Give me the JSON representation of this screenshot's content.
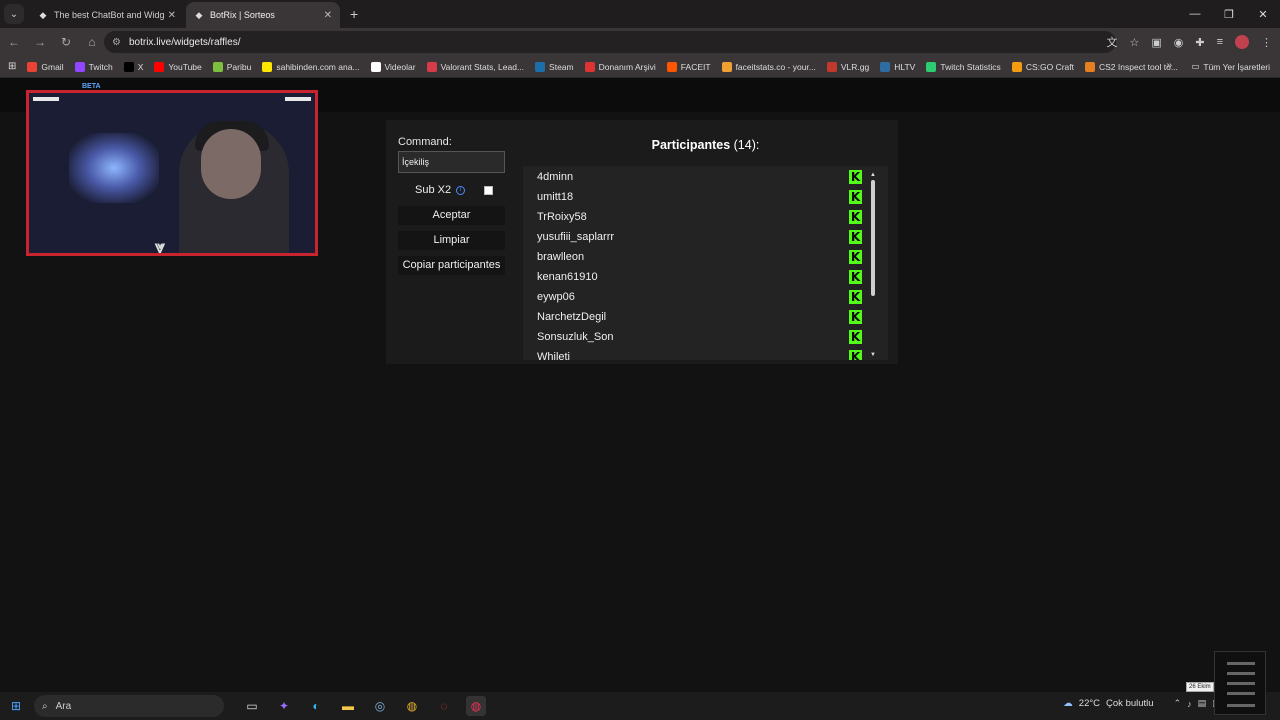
{
  "browser": {
    "tabs": [
      {
        "title": "The best ChatBot and Widgets",
        "active": false
      },
      {
        "title": "BotRix | Sorteos",
        "active": true
      }
    ],
    "new_tab": "+",
    "url": "botrix.live/widgets/raffles/",
    "bookmarks": [
      {
        "label": "Gmail",
        "color": "#ea4335"
      },
      {
        "label": "Twitch",
        "color": "#9146ff"
      },
      {
        "label": "X",
        "color": "#000000"
      },
      {
        "label": "YouTube",
        "color": "#ff0000"
      },
      {
        "label": "Paribu",
        "color": "#7fbf3f"
      },
      {
        "label": "sahibinden.com ana...",
        "color": "#ffe800"
      },
      {
        "label": "Videolar",
        "color": "#ffffff"
      },
      {
        "label": "Valorant Stats, Lead...",
        "color": "#d73a49"
      },
      {
        "label": "Steam",
        "color": "#1b6ea8"
      },
      {
        "label": "Donanım Arşivi",
        "color": "#d33"
      },
      {
        "label": "FACEIT",
        "color": "#ff5500"
      },
      {
        "label": "faceitstats.co - your...",
        "color": "#f0a030"
      },
      {
        "label": "VLR.gg",
        "color": "#c0392b"
      },
      {
        "label": "HLTV",
        "color": "#2d6da3"
      },
      {
        "label": "Twitch Statistics",
        "color": "#2ecc71"
      },
      {
        "label": "CS:GO Craft",
        "color": "#f39c12"
      },
      {
        "label": "CS2 Inspect tool to...",
        "color": "#e67e22"
      }
    ],
    "all_bookmarks": "Tüm Yer İşaretleri"
  },
  "overlay": {
    "beta": "BETA"
  },
  "raffle": {
    "command_label": "Command:",
    "command_value": "İçekiliş",
    "sub_label": "Sub X2",
    "accept_label": "Aceptar",
    "clear_label": "Limpiar",
    "copy_label": "Copiar participantes",
    "participants_label": "Participantes",
    "participants_count": "(14):",
    "participants": [
      "4dminn",
      "umitt18",
      "TrRoixy58",
      "yusufiii_saplarrr",
      "brawlleon",
      "kenan61910",
      "eywp06",
      "NarchetzDegil",
      "Sonsuzluk_Son",
      "Whileti"
    ],
    "platform_icon": "kick-icon",
    "kick_color": "#53fc18"
  },
  "taskbar": {
    "search_placeholder": "Ara",
    "weather": "22°C",
    "weather_desc": "Çok bulutlu",
    "date_tip": "26 Ekim"
  }
}
